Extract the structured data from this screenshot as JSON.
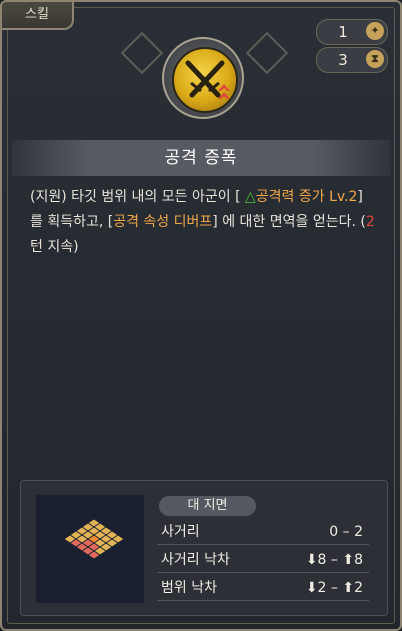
{
  "tab": {
    "label": "스킬"
  },
  "stats": [
    {
      "value": "1",
      "icon": "star-coin-icon"
    },
    {
      "value": "3",
      "icon": "hourglass-icon"
    }
  ],
  "skill": {
    "name": "공격 증폭",
    "icon": "crossed-swords-icon",
    "desc": {
      "p1": "(지원) 타깃 범위 내의 모든 아군이 [ ",
      "buff": "공격력 증가 Lv.2",
      "p2": "] 를 획득하고, [",
      "debuff": "공격 속성 디버프",
      "p3": "] 에 대한 면역을 얻는다. (",
      "turns": "2",
      "p4": "턴 지속)"
    }
  },
  "range": {
    "label": "대 지면",
    "rows": [
      {
        "key": "사거리",
        "value": "0 – 2"
      },
      {
        "key": "사거리 낙차",
        "value": "⬇8 – ⬆8"
      },
      {
        "key": "범위 낙차",
        "value": "⬇2 – ⬆2"
      }
    ]
  },
  "colors": {
    "accent": "#f0a84a",
    "turn_red": "#e0483c",
    "tile_orange": "#e3b456",
    "tile_red": "#e06a5c"
  }
}
